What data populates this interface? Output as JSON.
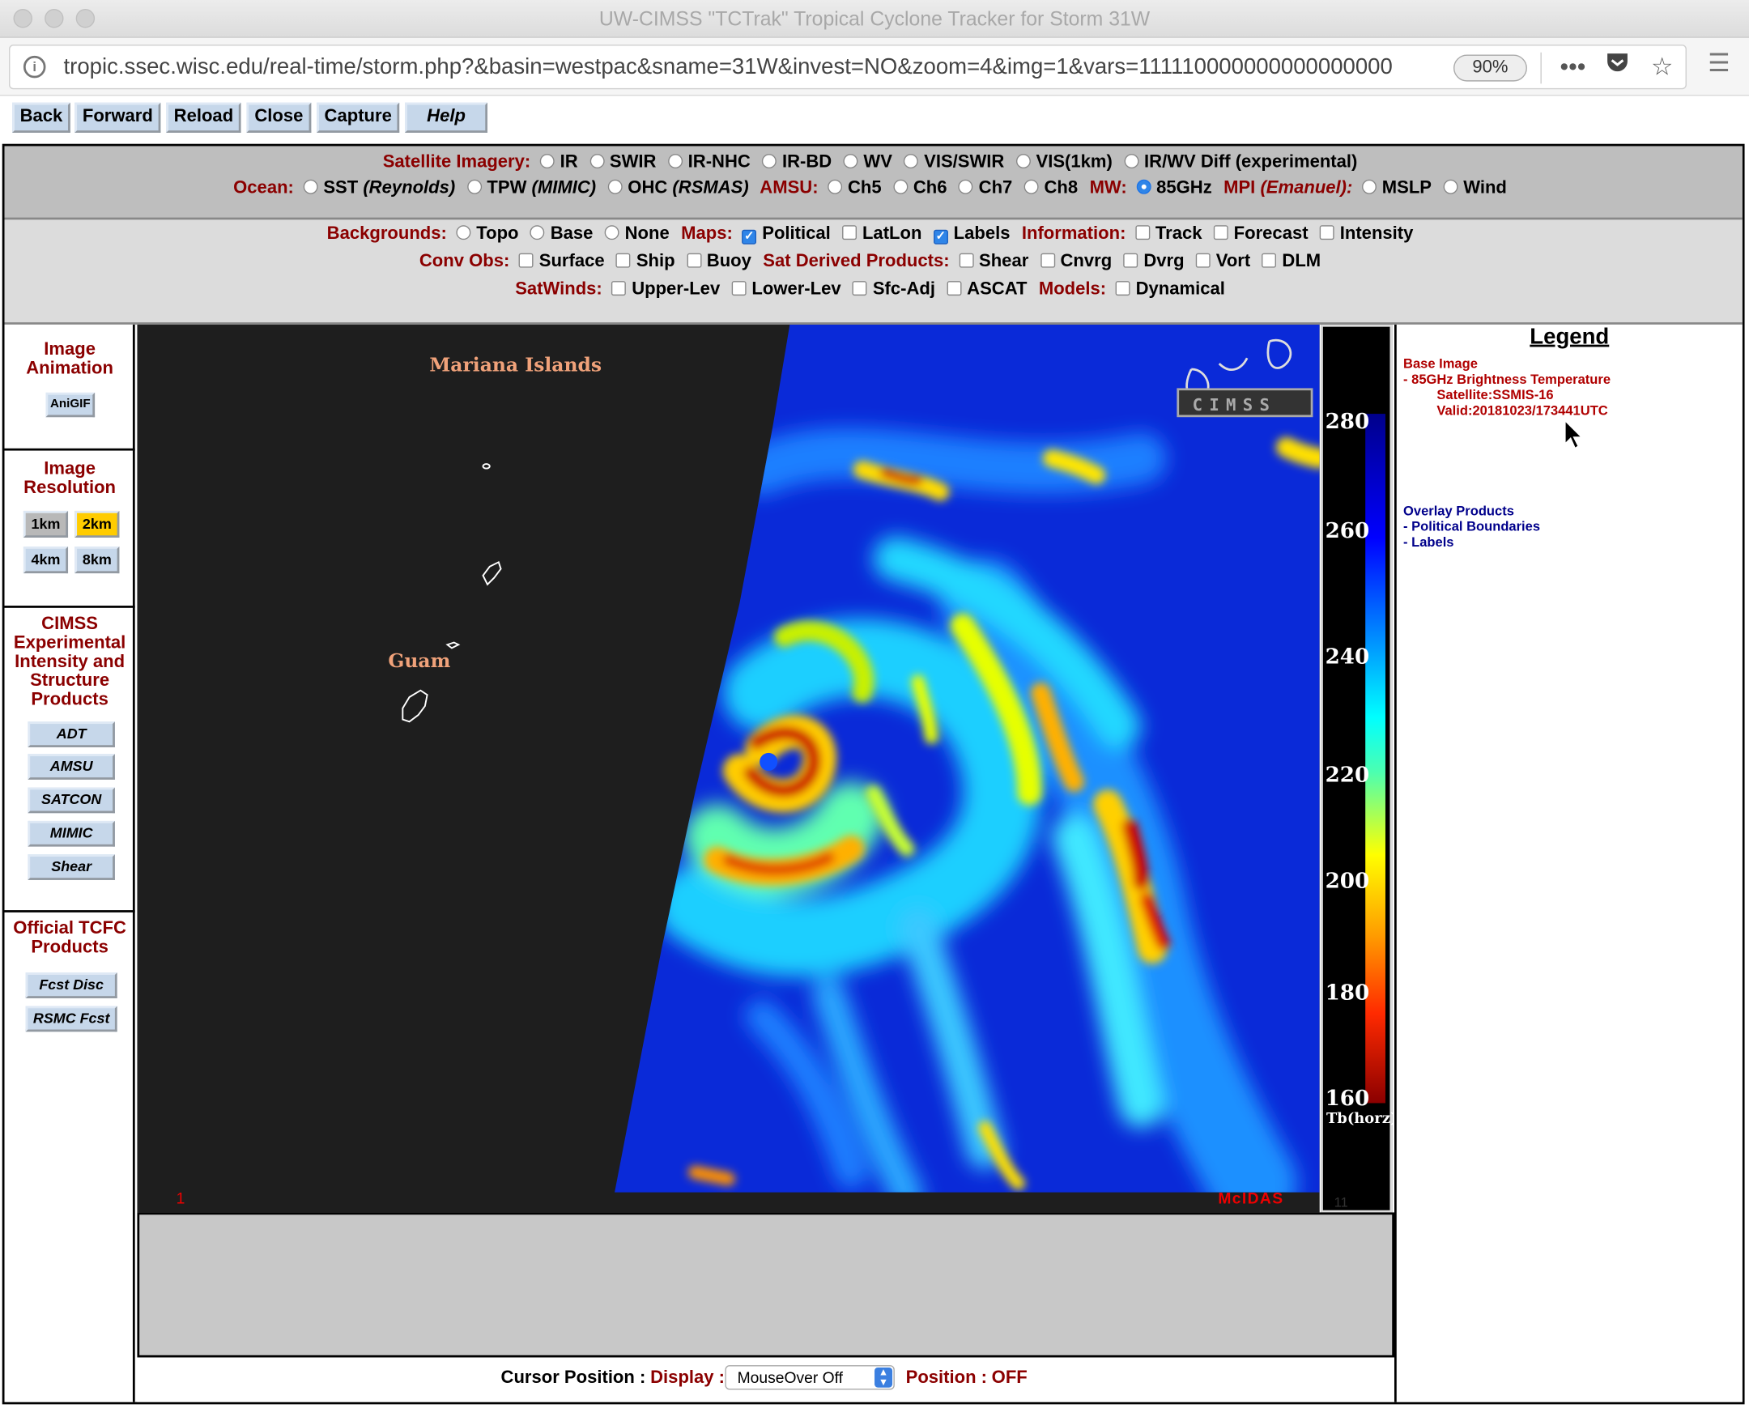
{
  "window": {
    "title": "UW-CIMSS \"TCTrak\" Tropical Cyclone Tracker for Storm 31W"
  },
  "address_bar": {
    "url": "tropic.ssec.wisc.edu/real-time/storm.php?&basin=westpac&sname=31W&invest=NO&zoom=4&img=1&vars=111110000000000000000",
    "zoom": "90%",
    "icons": [
      "info-icon",
      "more-icon",
      "pocket-icon",
      "bookmark-star-icon",
      "menu-icon"
    ]
  },
  "toolbar": {
    "back": "Back",
    "forward": "Forward",
    "reload": "Reload",
    "close": "Close",
    "capture": "Capture",
    "help": "Help"
  },
  "imagery": {
    "satellite_label": "Satellite Imagery:",
    "satellite_options": [
      "IR",
      "SWIR",
      "IR-NHC",
      "IR-BD",
      "WV",
      "VIS/SWIR",
      "VIS(1km)",
      "IR/WV Diff (experimental)"
    ],
    "ocean_label": "Ocean:",
    "sst": "SST",
    "sst_src": "(Reynolds)",
    "tpw": "TPW",
    "tpw_src": "(MIMIC)",
    "ohc": "OHC",
    "ohc_src": "(RSMAS)",
    "amsu_label": "AMSU:",
    "amsu_options": [
      "Ch5",
      "Ch6",
      "Ch7",
      "Ch8"
    ],
    "mw_label": "MW:",
    "mw_option": "85GHz",
    "mw_selected": true,
    "mpi_label": "MPI",
    "mpi_src": "(Emanuel):",
    "mpi_options": [
      "MSLP",
      "Wind"
    ]
  },
  "overlays": {
    "backgrounds_label": "Backgrounds:",
    "backgrounds": [
      "Topo",
      "Base",
      "None"
    ],
    "maps_label": "Maps:",
    "maps": [
      {
        "label": "Political",
        "checked": true
      },
      {
        "label": "LatLon",
        "checked": false
      },
      {
        "label": "Labels",
        "checked": true
      }
    ],
    "information_label": "Information:",
    "information": [
      "Track",
      "Forecast",
      "Intensity"
    ],
    "convobs_label": "Conv Obs:",
    "convobs": [
      "Surface",
      "Ship",
      "Buoy"
    ],
    "satderived_label": "Sat Derived Products:",
    "satderived": [
      "Shear",
      "Cnvrg",
      "Dvrg",
      "Vort",
      "DLM"
    ],
    "satwinds_label": "SatWinds:",
    "satwinds": [
      "Upper-Lev",
      "Lower-Lev",
      "Sfc-Adj",
      "ASCAT"
    ],
    "models_label": "Models:",
    "models": [
      "Dynamical"
    ]
  },
  "sidebar": {
    "animation_title": "Image Animation",
    "anigif": "AniGIF",
    "resolution_title": "Image Resolution",
    "res_1km": "1km",
    "res_2km": "2km",
    "res_4km": "4km",
    "res_8km": "8km",
    "res_selected": "2km",
    "cimss_title": "CIMSS Experimental Intensity and Structure Products",
    "cimss_products": [
      "ADT",
      "AMSU",
      "SATCON",
      "MIMIC",
      "Shear"
    ],
    "official_title": "Official TCFC Products",
    "official_products": [
      "Fcst Disc",
      "RSMC Fcst"
    ]
  },
  "map": {
    "label_mariana": "Mariana Islands",
    "label_guam": "Guam",
    "frame_number": "1",
    "mcidas": "McIDAS",
    "colorbar_ticks": [
      "280",
      "260",
      "240",
      "220",
      "200",
      "180",
      "160"
    ],
    "colorbar_unit": "Tb(horz)",
    "colorbar_footer": "11",
    "colors": {
      "background": "#1e1e1e",
      "cold": "#8b0000",
      "warm": "#00008b"
    }
  },
  "legend": {
    "title": "Legend",
    "base_image": "Base Image",
    "product": "-  85GHz Brightness Temperature",
    "satellite": "Satellite:SSMIS-16",
    "valid": "Valid:20181023/173441UTC",
    "overlay_title": "Overlay Products",
    "overlay_items": [
      "-  Political Boundaries",
      "-  Labels"
    ]
  },
  "cursor": {
    "label": "Cursor Position :",
    "display_label": "Display :",
    "display_value": "MouseOver Off",
    "position_label": "Position :",
    "position_value": "OFF"
  }
}
